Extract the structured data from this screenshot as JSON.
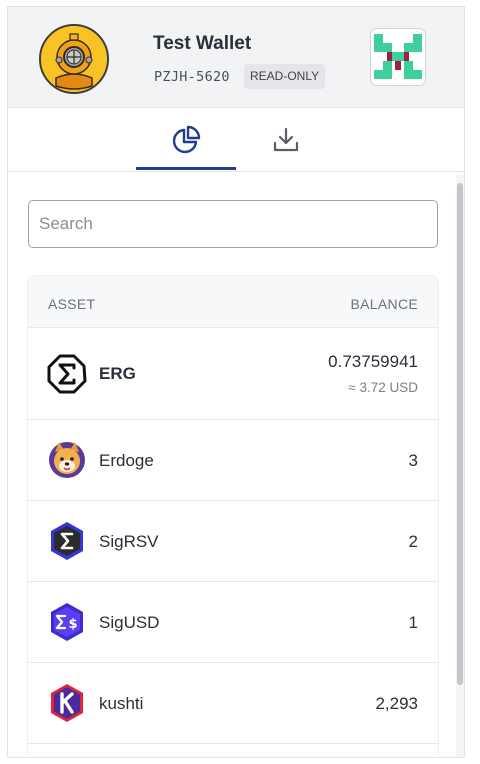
{
  "header": {
    "wallet_name": "Test Wallet",
    "wallet_id": "PZJH-5620",
    "badge": "READ-ONLY"
  },
  "tabs": [
    {
      "icon": "pie-chart-icon",
      "active": true
    },
    {
      "icon": "download-icon",
      "active": false
    }
  ],
  "search": {
    "placeholder": "Search",
    "value": ""
  },
  "asset_list": {
    "col_asset": "ASSET",
    "col_balance": "BALANCE",
    "items": [
      {
        "name": "ERG",
        "amount": "0.73759941",
        "usd": "≈ 3.72 USD",
        "icon": "ergo-icon"
      },
      {
        "name": "Erdoge",
        "amount": "3",
        "icon": "erdoge-icon"
      },
      {
        "name": "SigRSV",
        "amount": "2",
        "icon": "sigrsv-icon"
      },
      {
        "name": "SigUSD",
        "amount": "1",
        "icon": "sigusd-icon"
      },
      {
        "name": "kushti",
        "amount": "2,293",
        "icon": "kushti-icon"
      }
    ]
  },
  "colors": {
    "accent": "#1e3f8f",
    "header_bg": "#f2f3f5",
    "avatar_bg": "#f7c325"
  }
}
